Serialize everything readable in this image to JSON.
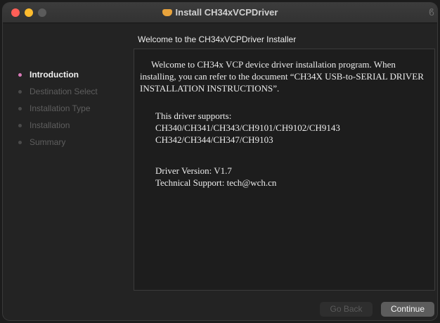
{
  "window": {
    "title": "Install CH34xVCPDriver",
    "lock_glyph": "ϐ"
  },
  "heading": "Welcome to the CH34xVCPDriver Installer",
  "sidebar": {
    "items": [
      {
        "label": "Introduction",
        "active": true
      },
      {
        "label": "Destination Select",
        "active": false
      },
      {
        "label": "Installation Type",
        "active": false
      },
      {
        "label": "Installation",
        "active": false
      },
      {
        "label": "Summary",
        "active": false
      }
    ]
  },
  "content": {
    "intro": "Welcome to CH34x VCP device driver installation program. When installing, you can refer to the document “CH34X USB-to-SERIAL DRIVER INSTALLATION INSTRUCTIONS”.",
    "supports_heading": "This driver supports:",
    "supports_line1": "CH340/CH341/CH343/CH9101/CH9102/CH9143",
    "supports_line2": "CH342/CH344/CH347/CH9103",
    "version": "Driver Version: V1.7",
    "support": "Technical Support: tech@wch.cn"
  },
  "buttons": {
    "back": "Go Back",
    "continue": "Continue"
  },
  "colors": {
    "active_dot": "#d97ab7",
    "close": "#ff5f57",
    "minimize": "#febc2e"
  }
}
